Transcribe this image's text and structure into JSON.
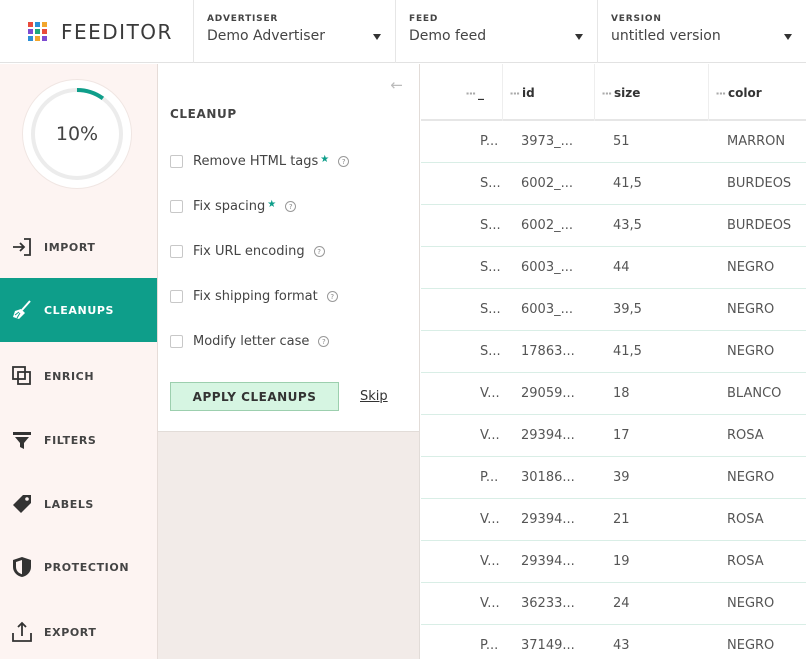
{
  "header": {
    "brand": "FEEDITOR",
    "logo_colors": [
      "#e94b3c",
      "#2b8fd6",
      "#f2a62c",
      "#7d4bd1",
      "#1ea97c",
      "#e94b3c",
      "#2b8fd6",
      "#f2a62c",
      "#7d4bd1"
    ],
    "advertiser": {
      "label": "ADVERTISER",
      "value": "Demo Advertiser"
    },
    "feed": {
      "label": "FEED",
      "value": "Demo feed"
    },
    "version": {
      "label": "VERSION",
      "value": "untitled version"
    }
  },
  "sidebar": {
    "progress": {
      "value": 10,
      "label": "10%"
    },
    "accent": "#0e9e8a",
    "items": [
      {
        "label": "IMPORT",
        "icon": "import-icon",
        "active": false
      },
      {
        "label": "CLEANUPS",
        "icon": "broom-icon",
        "active": true
      },
      {
        "label": "ENRICH",
        "icon": "layers-icon",
        "active": false
      },
      {
        "label": "FILTERS",
        "icon": "funnel-icon",
        "active": false
      },
      {
        "label": "LABELS",
        "icon": "tag-icon",
        "active": false
      },
      {
        "label": "PROTECTION",
        "icon": "shield-icon",
        "active": false
      },
      {
        "label": "EXPORT",
        "icon": "export-icon",
        "active": false
      }
    ]
  },
  "cleanup": {
    "title": "CLEANUP",
    "options": [
      {
        "label": "Remove HTML tags",
        "starred": true,
        "checked": false
      },
      {
        "label": "Fix spacing",
        "starred": true,
        "checked": false
      },
      {
        "label": "Fix URL encoding",
        "starred": false,
        "checked": false
      },
      {
        "label": "Fix shipping format",
        "starred": false,
        "checked": false
      },
      {
        "label": "Modify letter case",
        "starred": false,
        "checked": false
      }
    ],
    "apply_label": "APPLY CLEANUPS",
    "skip_label": "Skip"
  },
  "table": {
    "columns": [
      "_",
      "id",
      "size",
      "color"
    ],
    "rows": [
      [
        "P...",
        "3973_...",
        "51",
        "MARRON"
      ],
      [
        "S...",
        "6002_...",
        "41,5",
        "BURDEOS"
      ],
      [
        "S...",
        "6002_...",
        "43,5",
        "BURDEOS"
      ],
      [
        "S...",
        "6003_...",
        "44",
        "NEGRO"
      ],
      [
        "S...",
        "6003_...",
        "39,5",
        "NEGRO"
      ],
      [
        "S...",
        "17863...",
        "41,5",
        "NEGRO"
      ],
      [
        "V...",
        "29059...",
        "18",
        "BLANCO"
      ],
      [
        "V...",
        "29394...",
        "17",
        "ROSA"
      ],
      [
        "P...",
        "30186...",
        "39",
        "NEGRO"
      ],
      [
        "V...",
        "29394...",
        "21",
        "ROSA"
      ],
      [
        "V...",
        "29394...",
        "19",
        "ROSA"
      ],
      [
        "V...",
        "36233...",
        "24",
        "NEGRO"
      ],
      [
        "P...",
        "37149...",
        "43",
        "NEGRO"
      ]
    ]
  }
}
